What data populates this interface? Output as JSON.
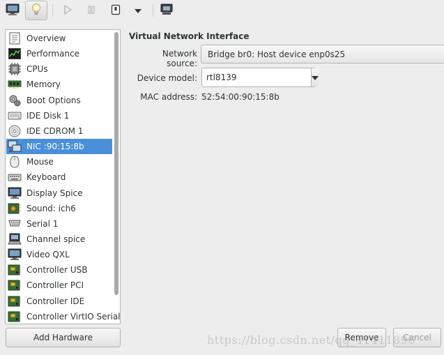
{
  "toolbar": {
    "buttons": [
      {
        "icon": "monitor-icon",
        "active": false,
        "enabled": true
      },
      {
        "icon": "lightbulb-icon",
        "active": true,
        "enabled": true
      },
      {
        "icon": "play-icon",
        "active": false,
        "enabled": false
      },
      {
        "icon": "pause-icon",
        "active": false,
        "enabled": false
      },
      {
        "icon": "shutdown-icon",
        "active": false,
        "enabled": true
      },
      {
        "icon": "chevron-down-icon",
        "active": false,
        "enabled": true
      },
      {
        "icon": "fullscreen-icon",
        "active": false,
        "enabled": true
      }
    ]
  },
  "sidebar": {
    "items": [
      {
        "label": "Overview",
        "icon": "overview-icon"
      },
      {
        "label": "Performance",
        "icon": "performance-icon"
      },
      {
        "label": "CPUs",
        "icon": "cpu-icon"
      },
      {
        "label": "Memory",
        "icon": "memory-icon"
      },
      {
        "label": "Boot Options",
        "icon": "boot-options-icon"
      },
      {
        "label": "IDE Disk 1",
        "icon": "disk-icon"
      },
      {
        "label": "IDE CDROM 1",
        "icon": "cdrom-icon"
      },
      {
        "label": "NIC :90:15:8b",
        "icon": "nic-icon",
        "selected": true
      },
      {
        "label": "Mouse",
        "icon": "mouse-icon"
      },
      {
        "label": "Keyboard",
        "icon": "keyboard-icon"
      },
      {
        "label": "Display Spice",
        "icon": "display-icon"
      },
      {
        "label": "Sound: ich6",
        "icon": "sound-icon"
      },
      {
        "label": "Serial 1",
        "icon": "serial-icon"
      },
      {
        "label": "Channel spice",
        "icon": "channel-icon"
      },
      {
        "label": "Video QXL",
        "icon": "video-icon"
      },
      {
        "label": "Controller USB",
        "icon": "controller-icon"
      },
      {
        "label": "Controller PCI",
        "icon": "controller-icon"
      },
      {
        "label": "Controller IDE",
        "icon": "controller-icon"
      },
      {
        "label": "Controller VirtIO Serial",
        "icon": "controller-icon"
      }
    ],
    "add_hardware_label": "Add Hardware"
  },
  "details": {
    "section_title": "Virtual Network Interface",
    "network_source_label": "Network source:",
    "network_source_value": "Bridge br0: Host device enp0s25",
    "device_model_label": "Device model:",
    "device_model_value": "rtl8139",
    "mac_label": "MAC address:",
    "mac_value": "52:54:00:90:15:8b"
  },
  "actions": {
    "remove_label": "Remove",
    "cancel_label": "Cancel"
  },
  "watermark": "https://blog.csdn.net/qq_41411896",
  "colors": {
    "selection": "#4a90d9",
    "window_bg": "#ededed",
    "text": "#2e3436"
  }
}
